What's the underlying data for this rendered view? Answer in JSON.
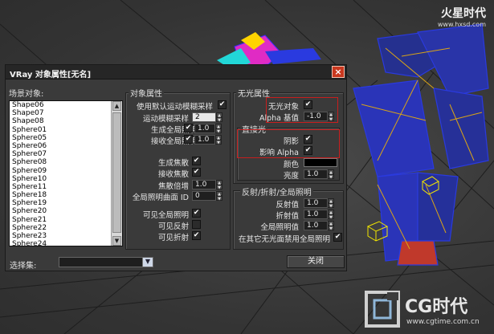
{
  "watermark": {
    "brand": "火星时代",
    "url": "www.hxsd.com"
  },
  "cg_logo": {
    "brand": "CG时代",
    "url": "www.cgtime.com.cn"
  },
  "dialog": {
    "title": "VRay 对象属性[无名]",
    "close_icon": "×",
    "scene_objects": {
      "label": "场景对象:",
      "items": [
        "Shape06",
        "Shape07",
        "Shape08",
        "Sphere01",
        "Sphere05",
        "Sphere06",
        "Sphere07",
        "Sphere08",
        "Sphere09",
        "Sphere10",
        "Sphere11",
        "Sphere18",
        "Sphere19",
        "Sphere20",
        "Sphere21",
        "Sphere22",
        "Sphere23",
        "Sphere24"
      ]
    },
    "object_props": {
      "label": "对象属性",
      "use_default_moblur": {
        "label": "使用默认运动模糊采样",
        "checked": true
      },
      "moblur_samples": {
        "label": "运动模糊采样",
        "value": "2"
      },
      "generate_gi": {
        "label": "生成全局照明",
        "checked": true,
        "value": "1.0"
      },
      "receive_gi": {
        "label": "接收全局照明",
        "checked": true,
        "value": "1.0"
      },
      "generate_caustics": {
        "label": "生成焦散",
        "checked": true
      },
      "receive_caustics": {
        "label": "接收焦散",
        "checked": true
      },
      "caustics_multiplier": {
        "label": "焦散倍增",
        "value": "1.0"
      },
      "gi_surface_id": {
        "label": "全局照明曲面 ID",
        "value": "0"
      },
      "visible_to_gi": {
        "label": "可见全局照明",
        "checked": true
      },
      "visible_to_reflections": {
        "label": "可见反射",
        "checked": false
      },
      "visible_to_refractions": {
        "label": "可见折射",
        "checked": true
      }
    },
    "matte_props": {
      "label": "无光属性",
      "matte_object": {
        "label": "无光对象",
        "checked": true
      },
      "alpha_contribution": {
        "label": "Alpha 基值",
        "value": "-1.0"
      },
      "direct_light": {
        "label": "直接光",
        "shadows": {
          "label": "阴影",
          "checked": true
        },
        "affect_alpha": {
          "label": "影响 Alpha",
          "checked": true
        },
        "color": {
          "label": "颜色",
          "value": "#000000"
        },
        "brightness": {
          "label": "亮度",
          "value": "1.0"
        }
      }
    },
    "refl_refr_gi": {
      "label": "反射/折射/全局照明",
      "reflection_amount": {
        "label": "反射值",
        "value": "1.0"
      },
      "refraction_amount": {
        "label": "折射值",
        "value": "1.0"
      },
      "gi_amount": {
        "label": "全局照明值",
        "value": "1.0"
      },
      "no_gi_on_other_mattes": {
        "label": "在其它无光面禁用全局照明",
        "checked": true
      }
    },
    "selection_set": {
      "label": "选择集:",
      "value": ""
    },
    "close_button": "关闭"
  },
  "colors": {
    "accent_red": "#c81e1e",
    "close_btn": "#c9381f"
  }
}
